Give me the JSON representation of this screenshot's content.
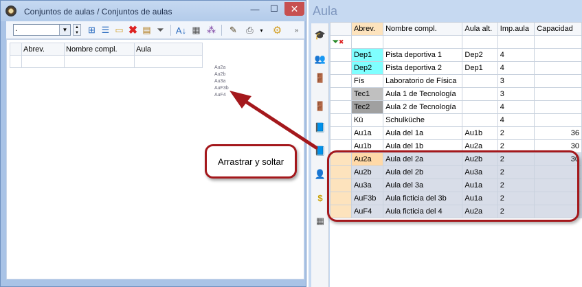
{
  "left_window": {
    "title": "Conjuntos de aulas / Conjuntos de aulas",
    "minimize_glyph": "—",
    "maximize_glyph": "☐",
    "close_glyph": "✕",
    "combo_value": ".",
    "overflow_glyph": "»",
    "columns": [
      "Abrev.",
      "Nombre compl.",
      "Aula"
    ],
    "drag_items": [
      "Au2a",
      "Au2b",
      "Au3a",
      "AuF3b",
      "AuF4"
    ]
  },
  "right_window": {
    "title": "Aula",
    "columns": [
      "Abrev.",
      "Nombre compl.",
      "Aula alt.",
      "Imp.aula",
      "Capacidad"
    ],
    "rows": [
      {
        "abrev": "Dep1",
        "nombre": "Pista deportiva 1",
        "alt": "Dep2",
        "imp": "4",
        "cap": "",
        "color": "#7fffff"
      },
      {
        "abrev": "Dep2",
        "nombre": "Pista deportiva 2",
        "alt": "Dep1",
        "imp": "4",
        "cap": "",
        "color": "#7fffff"
      },
      {
        "abrev": "Fís",
        "nombre": "Laboratorio de Física",
        "alt": "",
        "imp": "3",
        "cap": "",
        "color": ""
      },
      {
        "abrev": "Tec1",
        "nombre": "Aula 1 de Tecnología",
        "alt": "",
        "imp": "3",
        "cap": "",
        "color": "#c0c0c0"
      },
      {
        "abrev": "Tec2",
        "nombre": "Aula 2 de Tecnología",
        "alt": "",
        "imp": "4",
        "cap": "",
        "color": "#a0a0a0"
      },
      {
        "abrev": "Kü",
        "nombre": "Schulküche",
        "alt": "",
        "imp": "4",
        "cap": "",
        "color": ""
      },
      {
        "abrev": "Au1a",
        "nombre": "Aula del 1a",
        "alt": "Au1b",
        "imp": "2",
        "cap": "36",
        "color": ""
      },
      {
        "abrev": "Au1b",
        "nombre": "Aula del 1b",
        "alt": "Au2a",
        "imp": "2",
        "cap": "30",
        "color": ""
      },
      {
        "abrev": "Au2a",
        "nombre": "Aula del 2a",
        "alt": "Au2b",
        "imp": "2",
        "cap": "30",
        "color": "#ffd9a8"
      },
      {
        "abrev": "Au2b",
        "nombre": "Aula del 2b",
        "alt": "Au3a",
        "imp": "2",
        "cap": "",
        "color": ""
      },
      {
        "abrev": "Au3a",
        "nombre": "Aula del 3a",
        "alt": "Au1a",
        "imp": "2",
        "cap": "",
        "color": ""
      },
      {
        "abrev": "AuF3b",
        "nombre": "Aula ficticia del 3b",
        "alt": "Au1a",
        "imp": "2",
        "cap": "",
        "color": ""
      },
      {
        "abrev": "AuF4",
        "nombre": "Aula ficticia del 4",
        "alt": "Au2a",
        "imp": "2",
        "cap": "",
        "color": ""
      }
    ],
    "selected_rows": [
      "Au2a",
      "Au2b",
      "Au3a",
      "AuF3b",
      "AuF4"
    ]
  },
  "callout": {
    "text": "Arrastrar y soltar"
  },
  "icons": {
    "left_toolbar": [
      "new-row-icon",
      "columns-icon",
      "new-icon",
      "delete-icon",
      "edit-list-icon",
      "filter-icon",
      "sort-icon",
      "format-icon",
      "link-icon",
      "settings-icon",
      "print-icon",
      "gear-icon"
    ],
    "sidebar": [
      "teachers-icon",
      "students-icon",
      "rooms-icon",
      "room-sets-icon",
      "book-icon",
      "book-blue-icon",
      "person-icon",
      "money-icon",
      "timetable-icon"
    ]
  },
  "colors": {
    "accent": "#a4181c",
    "selected_row_bg": "#d8dde8",
    "selected_row_handle": "#fde3bd"
  }
}
